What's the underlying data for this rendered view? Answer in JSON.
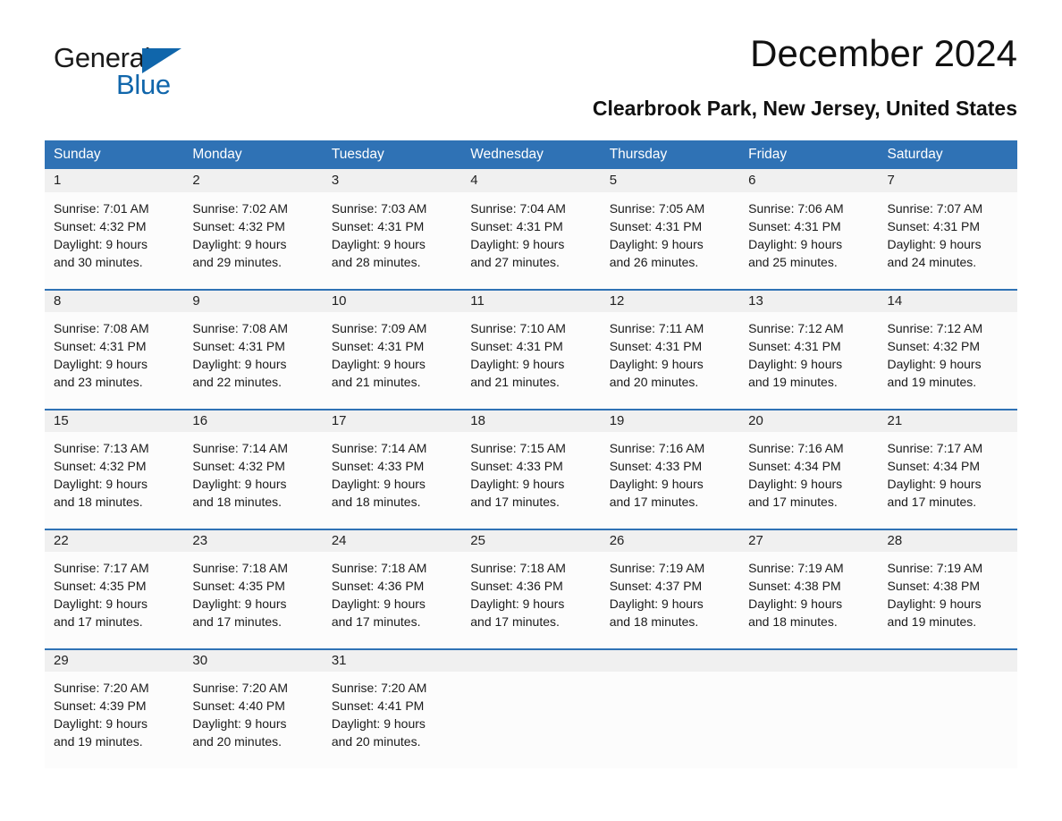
{
  "brand": {
    "word1": "General",
    "word2": "Blue",
    "triangle_color": "#1066ab"
  },
  "header": {
    "title": "December 2024",
    "subtitle": "Clearbrook Park, New Jersey, United States",
    "accent_color": "#2f72b5",
    "date_band_color": "#f0f0f0"
  },
  "weekdays": [
    "Sunday",
    "Monday",
    "Tuesday",
    "Wednesday",
    "Thursday",
    "Friday",
    "Saturday"
  ],
  "weeks": [
    {
      "days": [
        {
          "date": "1",
          "sunrise": "Sunrise: 7:01 AM",
          "sunset": "Sunset: 4:32 PM",
          "daylight_line1": "Daylight: 9 hours",
          "daylight_line2": "and 30 minutes."
        },
        {
          "date": "2",
          "sunrise": "Sunrise: 7:02 AM",
          "sunset": "Sunset: 4:32 PM",
          "daylight_line1": "Daylight: 9 hours",
          "daylight_line2": "and 29 minutes."
        },
        {
          "date": "3",
          "sunrise": "Sunrise: 7:03 AM",
          "sunset": "Sunset: 4:31 PM",
          "daylight_line1": "Daylight: 9 hours",
          "daylight_line2": "and 28 minutes."
        },
        {
          "date": "4",
          "sunrise": "Sunrise: 7:04 AM",
          "sunset": "Sunset: 4:31 PM",
          "daylight_line1": "Daylight: 9 hours",
          "daylight_line2": "and 27 minutes."
        },
        {
          "date": "5",
          "sunrise": "Sunrise: 7:05 AM",
          "sunset": "Sunset: 4:31 PM",
          "daylight_line1": "Daylight: 9 hours",
          "daylight_line2": "and 26 minutes."
        },
        {
          "date": "6",
          "sunrise": "Sunrise: 7:06 AM",
          "sunset": "Sunset: 4:31 PM",
          "daylight_line1": "Daylight: 9 hours",
          "daylight_line2": "and 25 minutes."
        },
        {
          "date": "7",
          "sunrise": "Sunrise: 7:07 AM",
          "sunset": "Sunset: 4:31 PM",
          "daylight_line1": "Daylight: 9 hours",
          "daylight_line2": "and 24 minutes."
        }
      ]
    },
    {
      "days": [
        {
          "date": "8",
          "sunrise": "Sunrise: 7:08 AM",
          "sunset": "Sunset: 4:31 PM",
          "daylight_line1": "Daylight: 9 hours",
          "daylight_line2": "and 23 minutes."
        },
        {
          "date": "9",
          "sunrise": "Sunrise: 7:08 AM",
          "sunset": "Sunset: 4:31 PM",
          "daylight_line1": "Daylight: 9 hours",
          "daylight_line2": "and 22 minutes."
        },
        {
          "date": "10",
          "sunrise": "Sunrise: 7:09 AM",
          "sunset": "Sunset: 4:31 PM",
          "daylight_line1": "Daylight: 9 hours",
          "daylight_line2": "and 21 minutes."
        },
        {
          "date": "11",
          "sunrise": "Sunrise: 7:10 AM",
          "sunset": "Sunset: 4:31 PM",
          "daylight_line1": "Daylight: 9 hours",
          "daylight_line2": "and 21 minutes."
        },
        {
          "date": "12",
          "sunrise": "Sunrise: 7:11 AM",
          "sunset": "Sunset: 4:31 PM",
          "daylight_line1": "Daylight: 9 hours",
          "daylight_line2": "and 20 minutes."
        },
        {
          "date": "13",
          "sunrise": "Sunrise: 7:12 AM",
          "sunset": "Sunset: 4:31 PM",
          "daylight_line1": "Daylight: 9 hours",
          "daylight_line2": "and 19 minutes."
        },
        {
          "date": "14",
          "sunrise": "Sunrise: 7:12 AM",
          "sunset": "Sunset: 4:32 PM",
          "daylight_line1": "Daylight: 9 hours",
          "daylight_line2": "and 19 minutes."
        }
      ]
    },
    {
      "days": [
        {
          "date": "15",
          "sunrise": "Sunrise: 7:13 AM",
          "sunset": "Sunset: 4:32 PM",
          "daylight_line1": "Daylight: 9 hours",
          "daylight_line2": "and 18 minutes."
        },
        {
          "date": "16",
          "sunrise": "Sunrise: 7:14 AM",
          "sunset": "Sunset: 4:32 PM",
          "daylight_line1": "Daylight: 9 hours",
          "daylight_line2": "and 18 minutes."
        },
        {
          "date": "17",
          "sunrise": "Sunrise: 7:14 AM",
          "sunset": "Sunset: 4:33 PM",
          "daylight_line1": "Daylight: 9 hours",
          "daylight_line2": "and 18 minutes."
        },
        {
          "date": "18",
          "sunrise": "Sunrise: 7:15 AM",
          "sunset": "Sunset: 4:33 PM",
          "daylight_line1": "Daylight: 9 hours",
          "daylight_line2": "and 17 minutes."
        },
        {
          "date": "19",
          "sunrise": "Sunrise: 7:16 AM",
          "sunset": "Sunset: 4:33 PM",
          "daylight_line1": "Daylight: 9 hours",
          "daylight_line2": "and 17 minutes."
        },
        {
          "date": "20",
          "sunrise": "Sunrise: 7:16 AM",
          "sunset": "Sunset: 4:34 PM",
          "daylight_line1": "Daylight: 9 hours",
          "daylight_line2": "and 17 minutes."
        },
        {
          "date": "21",
          "sunrise": "Sunrise: 7:17 AM",
          "sunset": "Sunset: 4:34 PM",
          "daylight_line1": "Daylight: 9 hours",
          "daylight_line2": "and 17 minutes."
        }
      ]
    },
    {
      "days": [
        {
          "date": "22",
          "sunrise": "Sunrise: 7:17 AM",
          "sunset": "Sunset: 4:35 PM",
          "daylight_line1": "Daylight: 9 hours",
          "daylight_line2": "and 17 minutes."
        },
        {
          "date": "23",
          "sunrise": "Sunrise: 7:18 AM",
          "sunset": "Sunset: 4:35 PM",
          "daylight_line1": "Daylight: 9 hours",
          "daylight_line2": "and 17 minutes."
        },
        {
          "date": "24",
          "sunrise": "Sunrise: 7:18 AM",
          "sunset": "Sunset: 4:36 PM",
          "daylight_line1": "Daylight: 9 hours",
          "daylight_line2": "and 17 minutes."
        },
        {
          "date": "25",
          "sunrise": "Sunrise: 7:18 AM",
          "sunset": "Sunset: 4:36 PM",
          "daylight_line1": "Daylight: 9 hours",
          "daylight_line2": "and 17 minutes."
        },
        {
          "date": "26",
          "sunrise": "Sunrise: 7:19 AM",
          "sunset": "Sunset: 4:37 PM",
          "daylight_line1": "Daylight: 9 hours",
          "daylight_line2": "and 18 minutes."
        },
        {
          "date": "27",
          "sunrise": "Sunrise: 7:19 AM",
          "sunset": "Sunset: 4:38 PM",
          "daylight_line1": "Daylight: 9 hours",
          "daylight_line2": "and 18 minutes."
        },
        {
          "date": "28",
          "sunrise": "Sunrise: 7:19 AM",
          "sunset": "Sunset: 4:38 PM",
          "daylight_line1": "Daylight: 9 hours",
          "daylight_line2": "and 19 minutes."
        }
      ]
    },
    {
      "days": [
        {
          "date": "29",
          "sunrise": "Sunrise: 7:20 AM",
          "sunset": "Sunset: 4:39 PM",
          "daylight_line1": "Daylight: 9 hours",
          "daylight_line2": "and 19 minutes."
        },
        {
          "date": "30",
          "sunrise": "Sunrise: 7:20 AM",
          "sunset": "Sunset: 4:40 PM",
          "daylight_line1": "Daylight: 9 hours",
          "daylight_line2": "and 20 minutes."
        },
        {
          "date": "31",
          "sunrise": "Sunrise: 7:20 AM",
          "sunset": "Sunset: 4:41 PM",
          "daylight_line1": "Daylight: 9 hours",
          "daylight_line2": "and 20 minutes."
        },
        {
          "date": "",
          "sunrise": "",
          "sunset": "",
          "daylight_line1": "",
          "daylight_line2": ""
        },
        {
          "date": "",
          "sunrise": "",
          "sunset": "",
          "daylight_line1": "",
          "daylight_line2": ""
        },
        {
          "date": "",
          "sunrise": "",
          "sunset": "",
          "daylight_line1": "",
          "daylight_line2": ""
        },
        {
          "date": "",
          "sunrise": "",
          "sunset": "",
          "daylight_line1": "",
          "daylight_line2": ""
        }
      ]
    }
  ]
}
